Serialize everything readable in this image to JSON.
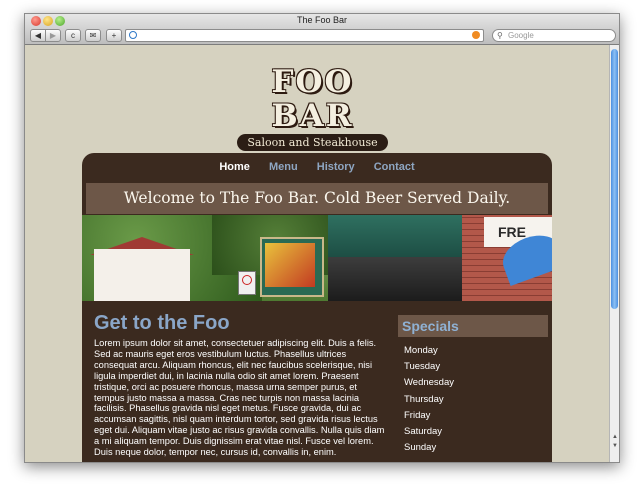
{
  "window": {
    "title": "The Foo Bar"
  },
  "toolbar": {
    "back_label": "◀",
    "forward_label": "▶",
    "reload_label": "c",
    "bookmark_label": "✉",
    "newtab_label": "+",
    "address": "",
    "search_placeholder": "Google"
  },
  "site": {
    "logo_main": "FOO BAR",
    "logo_tagline": "Saloon and Steakhouse",
    "nav": [
      "Home",
      "Menu",
      "History",
      "Contact"
    ],
    "welcome": "Welcome to The Foo Bar. Cold Beer Served Daily.",
    "hero_sign_text": "FRE",
    "main": {
      "heading": "Get to the Foo",
      "body": "Lorem ipsum dolor sit amet, consectetuer adipiscing elit. Duis a felis. Sed ac mauris eget eros vestibulum luctus. Phasellus ultrices consequat arcu. Aliquam rhoncus, elit nec faucibus scelerisque, nisi ligula imperdiet dui, in lacinia nulla odio sit amet lorem. Praesent tristique, orci ac posuere rhoncus, massa urna semper purus, et tempus justo massa a massa. Cras nec turpis non massa lacinia facilisis. Phasellus gravida nisl eget metus. Fusce gravida, dui ac accumsan sagittis, nisl quam interdum tortor, sed gravida risus lectus eget dui. Aliquam vitae justo ac risus gravida convallis. Nulla quis diam a mi aliquam tempor. Duis dignissim erat vitae nisl. Fusce vel lorem. Duis neque dolor, tempor nec, cursus id, convallis in, enim."
    },
    "specials": {
      "heading": "Specials",
      "days": [
        "Monday",
        "Tuesday",
        "Wednesday",
        "Thursday",
        "Friday",
        "Saturday",
        "Sunday"
      ]
    }
  },
  "colors": {
    "page_bg": "#d6d2c0",
    "panel_bg": "#3b2a1f",
    "band_bg": "#6d5748",
    "heading_blue": "#8aa6c8"
  }
}
